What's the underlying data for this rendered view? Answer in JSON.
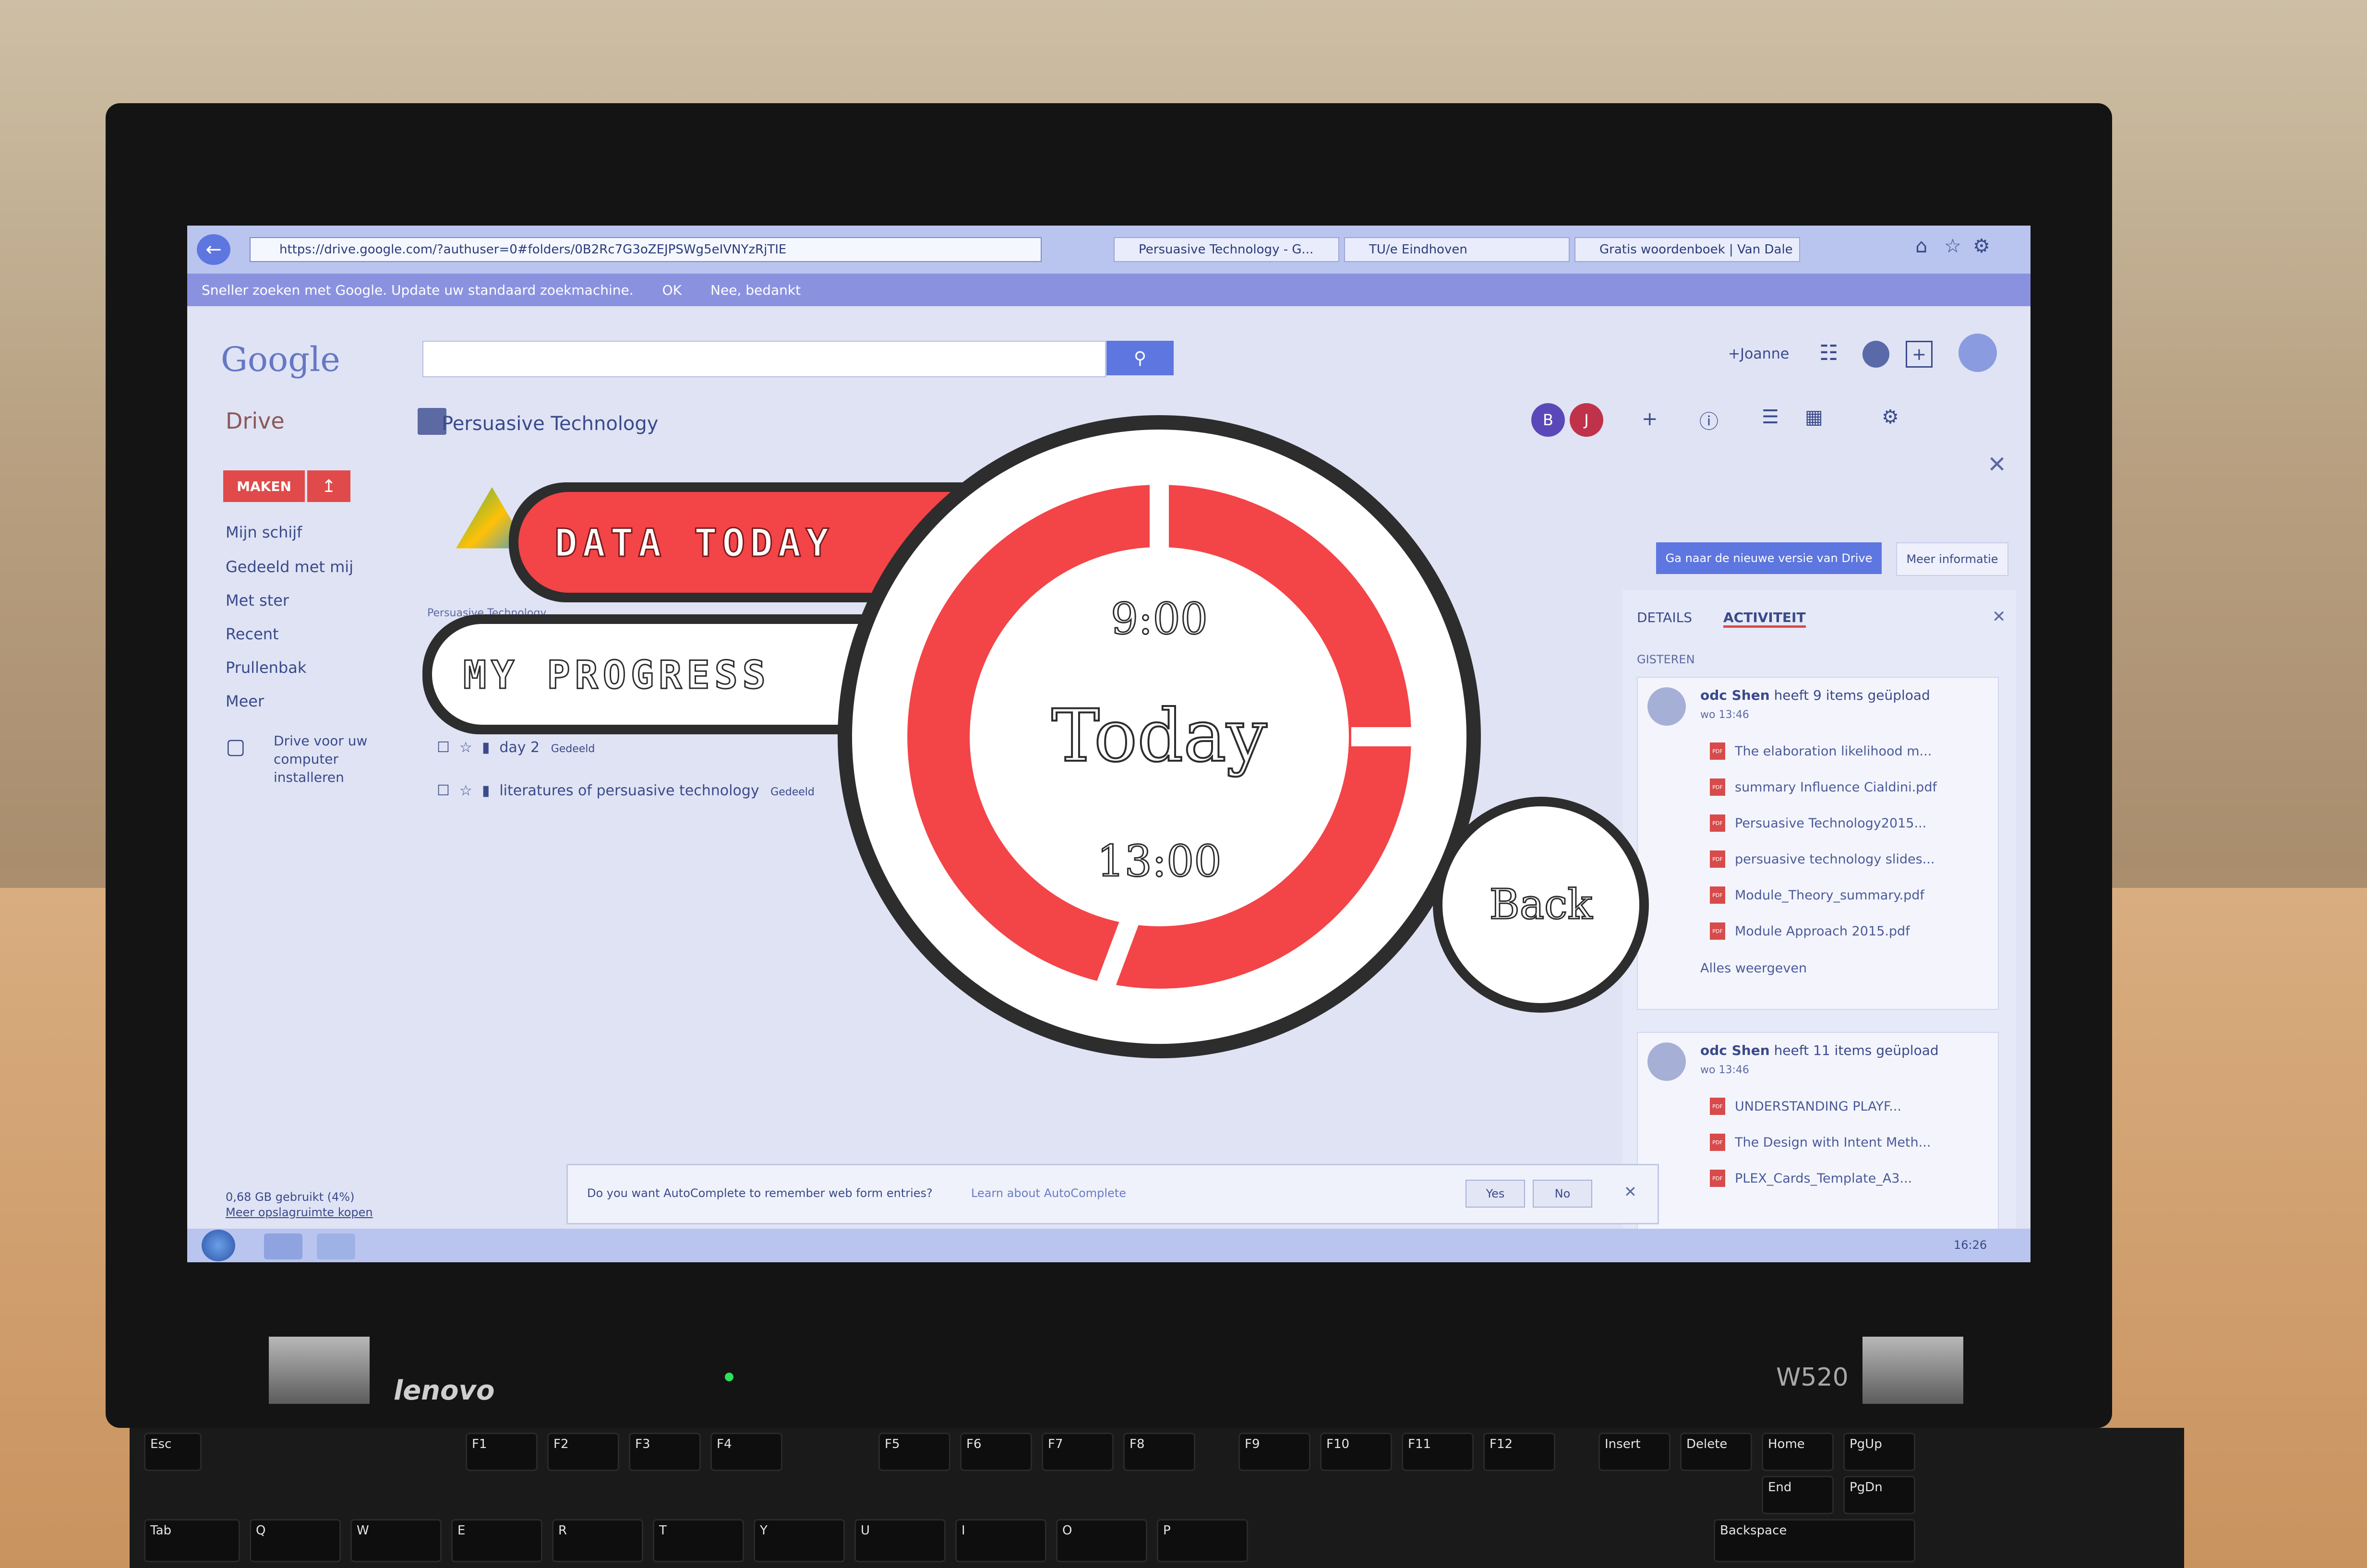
{
  "browser": {
    "url": "https://drive.google.com/?authuser=0#folders/0B2Rc7G3oZEJPSWg5eIVNYzRjTIE",
    "tabs": [
      {
        "label": "Persuasive Technology - G..."
      },
      {
        "label": "TU/e Eindhoven"
      },
      {
        "label": "Gratis woordenboek | Van Dale"
      }
    ],
    "notice": {
      "text": "Sneller zoeken met Google. Update uw standaard zoekmachine.",
      "ok": "OK",
      "decline": "Nee, bedankt"
    }
  },
  "google": {
    "logo": "Google",
    "user": "+Joanne"
  },
  "drive": {
    "title": "Drive",
    "create_button": "MAKEN",
    "nav": [
      "Mijn schijf",
      "Gedeeld met mij",
      "Met ster",
      "Recent",
      "Prullenbak",
      "Meer"
    ],
    "install": [
      "Drive voor uw",
      "computer",
      "installeren"
    ],
    "storage_used": "0,68 GB gebruikt (4%)",
    "storage_buy": "Meer opslagruimte kopen",
    "folder_title": "Persuasive Technology",
    "breadcrumb": "Persuasive Technology",
    "files": [
      {
        "name": "day 2",
        "tag": "Gedeeld"
      },
      {
        "name": "literatures of persuasive technology",
        "tag": "Gedeeld"
      }
    ],
    "promo_button": "Ga naar de nieuwe versie van Drive",
    "promo_more": "Meer informatie"
  },
  "activity_panel": {
    "tabs": [
      "DETAILS",
      "ACTIVITEIT"
    ],
    "section": "GISTEREN",
    "items": [
      {
        "user": "odc Shen",
        "action": "heeft 9 items geüpload",
        "time": "wo 13:46",
        "files": [
          "The elaboration likelihood m...",
          "summary Influence Cialdini.pdf",
          "Persuasive Technology2015...",
          "persuasive technology slides...",
          "Module_Theory_summary.pdf",
          "Module Approach 2015.pdf"
        ],
        "more": "Alles weergeven"
      },
      {
        "user": "odc Shen",
        "action": "heeft 11 items geüpload",
        "time": "wo 13:46",
        "files": [
          "UNDERSTANDING PLAYF...",
          "The Design with Intent Meth...",
          "PLEX_Cards_Template_A3..."
        ]
      }
    ]
  },
  "autocomplete": {
    "question": "Do you want AutoComplete to remember web form entries?",
    "learn": "Learn about AutoComplete",
    "yes": "Yes",
    "no": "No"
  },
  "taskbar": {
    "clock": "16:26"
  },
  "overlay": {
    "data_today": "DATA TODAY",
    "my_progress": "MY PROGRESS",
    "center": "Today",
    "start_time": "9:00",
    "end_time": "13:00",
    "back": "Back",
    "accent_color": "#f34448",
    "ring_color": "#2d2d2d"
  },
  "laptop": {
    "brand": "lenovo",
    "model": "W520",
    "keys": [
      "Esc",
      "F1",
      "F2",
      "F3",
      "F4",
      "F5",
      "F6",
      "F7",
      "F8",
      "F9",
      "F10",
      "F11",
      "F12",
      "Insert",
      "Delete",
      "Home",
      "End",
      "PgUp",
      "PgDn",
      "Backspace",
      "Tab",
      "Q",
      "W",
      "E",
      "R",
      "T",
      "Y",
      "U",
      "I",
      "O",
      "P"
    ]
  }
}
